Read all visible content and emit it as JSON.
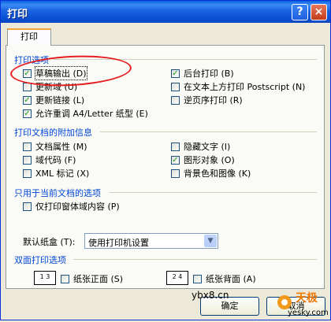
{
  "window": {
    "title": "打印",
    "help_icon": "?",
    "close_icon": "×"
  },
  "tabs": [
    {
      "label": "打印"
    }
  ],
  "groups": {
    "print_options": {
      "title": "打印选项",
      "left": [
        {
          "label": "草稿输出 (D)",
          "checked": true
        },
        {
          "label": "更新域 (U)",
          "checked": false
        },
        {
          "label": "更新链接 (L)",
          "checked": true
        },
        {
          "label": "允许重调 A4/Letter 纸型 (E)",
          "checked": true
        }
      ],
      "right": [
        {
          "label": "后台打印 (B)",
          "checked": true
        },
        {
          "label": "在文本上方打印 Postscript (N)",
          "checked": false
        },
        {
          "label": "逆页序打印 (R)",
          "checked": false
        }
      ]
    },
    "include_with_document": {
      "title": "打印文档的附加信息",
      "left": [
        {
          "label": "文档属性 (M)",
          "checked": false
        },
        {
          "label": "域代码 (F)",
          "checked": false
        },
        {
          "label": "XML 标记 (X)",
          "checked": false
        }
      ],
      "right": [
        {
          "label": "隐藏文字 (I)",
          "checked": false
        },
        {
          "label": "图形对象 (O)",
          "checked": true
        },
        {
          "label": "背景色和图像 (K)",
          "checked": false
        }
      ]
    },
    "current_document_only": {
      "title": "只用于当前文档的选项",
      "items": [
        {
          "label": "仅打印窗体域内容 (P)",
          "checked": false
        }
      ]
    },
    "tray": {
      "label": "默认纸盒 (T):",
      "value": "使用打印机设置"
    },
    "duplex": {
      "title": "双面打印选项",
      "front": {
        "label": "纸张正面 (S)",
        "checked": false,
        "icon_text": "1 3"
      },
      "back": {
        "label": "纸张背面 (A)",
        "checked": false,
        "icon_text": "2 4"
      }
    }
  },
  "buttons": {
    "ok": "确定",
    "cancel": "取消"
  },
  "watermark": {
    "site1": "ybx8.cn",
    "site2": "yesky.com",
    "logo_text": "天极"
  },
  "colors": {
    "title_bar": "#0a4fd2",
    "group_title": "#0046d5",
    "checkmark": "#21a121",
    "highlight_oval": "#e31f1f"
  }
}
